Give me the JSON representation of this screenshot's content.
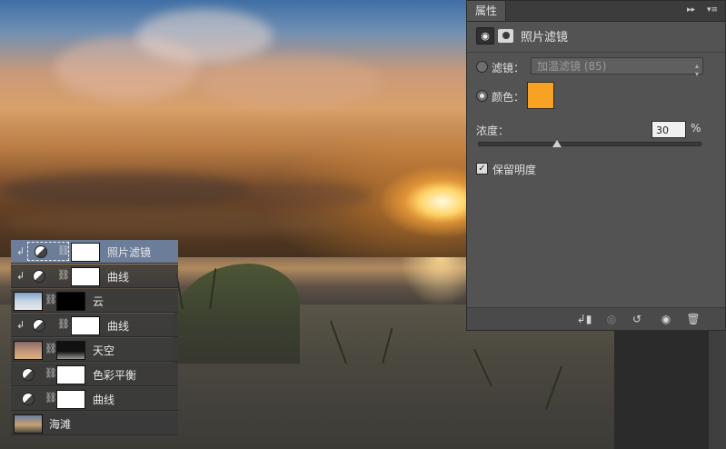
{
  "properties_panel": {
    "tab_label": "属性",
    "adjustment_title": "照片滤镜",
    "filter_label": "滤镜：",
    "filter_value": "加温滤镜 (85)",
    "color_label": "颜色：",
    "color_value": "#f8a223",
    "selected_mode": "color",
    "density_label": "浓度：",
    "density_value": "30",
    "density_unit": "%",
    "density_fraction": 0.3,
    "preserve_luminosity_label": "保留明度",
    "preserve_luminosity_checked": true,
    "footer_icons": [
      "clip-to-layer-icon",
      "view-previous-icon",
      "reset-icon",
      "visibility-icon",
      "trash-icon"
    ]
  },
  "layers": [
    {
      "name": "照片滤镜",
      "type": "adjustment",
      "clipped": true,
      "selected": true,
      "icon": "adjustment-icon"
    },
    {
      "name": "曲线",
      "type": "adjustment",
      "clipped": true,
      "selected": false,
      "icon": "adjustment-icon"
    },
    {
      "name": "云",
      "type": "image-with-mask",
      "clipped": false,
      "selected": false
    },
    {
      "name": "曲线",
      "type": "adjustment",
      "clipped": true,
      "selected": false,
      "icon": "adjustment-icon"
    },
    {
      "name": "天空",
      "type": "image-with-mask",
      "clipped": false,
      "selected": false
    },
    {
      "name": "色彩平衡",
      "type": "adjustment",
      "clipped": false,
      "selected": false,
      "icon": "adjustment-icon"
    },
    {
      "name": "曲线",
      "type": "adjustment",
      "clipped": false,
      "selected": false,
      "icon": "adjustment-icon"
    },
    {
      "name": "海滩",
      "type": "image",
      "clipped": false,
      "selected": false
    }
  ],
  "colors": {
    "panel_bg": "#535353",
    "selected_layer": "#6b7d99",
    "swatch": "#f8a223"
  }
}
